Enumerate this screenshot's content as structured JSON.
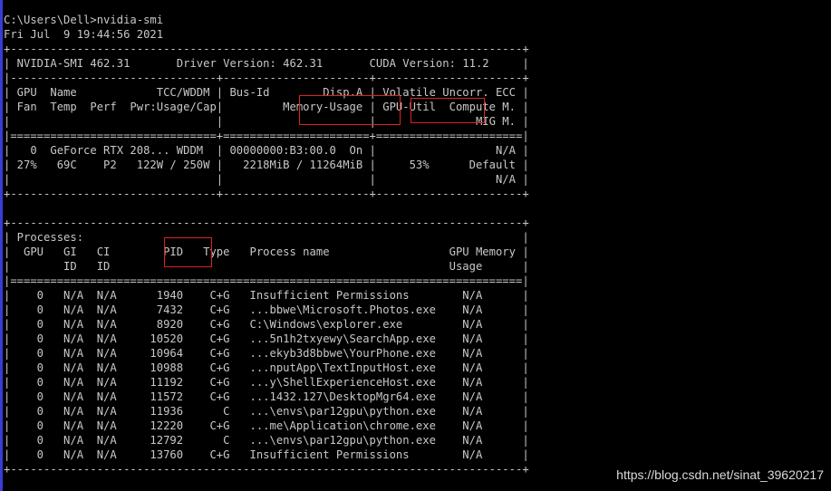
{
  "terminal": {
    "lines": [
      "C:\\Users\\Dell>nvidia-smi",
      "Fri Jul  9 19:44:56 2021",
      "+-----------------------------------------------------------------------------+",
      "| NVIDIA-SMI 462.31       Driver Version: 462.31       CUDA Version: 11.2     |",
      "|-------------------------------+----------------------+----------------------+",
      "| GPU  Name            TCC/WDDM | Bus-Id        Disp.A | Volatile Uncorr. ECC |",
      "| Fan  Temp  Perf  Pwr:Usage/Cap|         Memory-Usage | GPU-Util  Compute M. |",
      "|                               |                      |               MIG M. |",
      "|===============================+======================+======================|",
      "|   0  GeForce RTX 208... WDDM  | 00000000:B3:00.0  On |                  N/A |",
      "| 27%   69C    P2   122W / 250W |   2218MiB / 11264MiB |     53%      Default |",
      "|                               |                      |                  N/A |",
      "+-------------------------------+----------------------+----------------------+",
      "",
      "+-----------------------------------------------------------------------------+",
      "| Processes:                                                                  |",
      "|  GPU   GI   CI        PID   Type   Process name                  GPU Memory |",
      "|        ID   ID                                                   Usage      |",
      "|=============================================================================|",
      "|    0   N/A  N/A      1940    C+G   Insufficient Permissions        N/A      |",
      "|    0   N/A  N/A      7432    C+G   ...bbwe\\Microsoft.Photos.exe    N/A      |",
      "|    0   N/A  N/A      8920    C+G   C:\\Windows\\explorer.exe         N/A      |",
      "|    0   N/A  N/A     10520    C+G   ...5n1h2txyewy\\SearchApp.exe    N/A      |",
      "|    0   N/A  N/A     10964    C+G   ...ekyb3d8bbwe\\YourPhone.exe    N/A      |",
      "|    0   N/A  N/A     10988    C+G   ...nputApp\\TextInputHost.exe    N/A      |",
      "|    0   N/A  N/A     11192    C+G   ...y\\ShellExperienceHost.exe    N/A      |",
      "|    0   N/A  N/A     11572    C+G   ...1432.127\\DesktopMgr64.exe    N/A      |",
      "|    0   N/A  N/A     11936      C   ...\\envs\\par12gpu\\python.exe    N/A      |",
      "|    0   N/A  N/A     12220    C+G   ...me\\Application\\chrome.exe    N/A      |",
      "|    0   N/A  N/A     12792      C   ...\\envs\\par12gpu\\python.exe    N/A      |",
      "|    0   N/A  N/A     13760    C+G   Insufficient Permissions        N/A      |",
      "+-----------------------------------------------------------------------------+"
    ]
  },
  "highlights": [
    {
      "label": "Memory-Usage"
    },
    {
      "label": "GPU-Util"
    },
    {
      "label": "PID"
    }
  ],
  "watermark": "https://blog.csdn.net/sinat_39620217",
  "colors": {
    "background": "#000000",
    "text": "#c8c8c8",
    "highlight": "#dd2222",
    "left_bar": "#3b3bd6"
  }
}
